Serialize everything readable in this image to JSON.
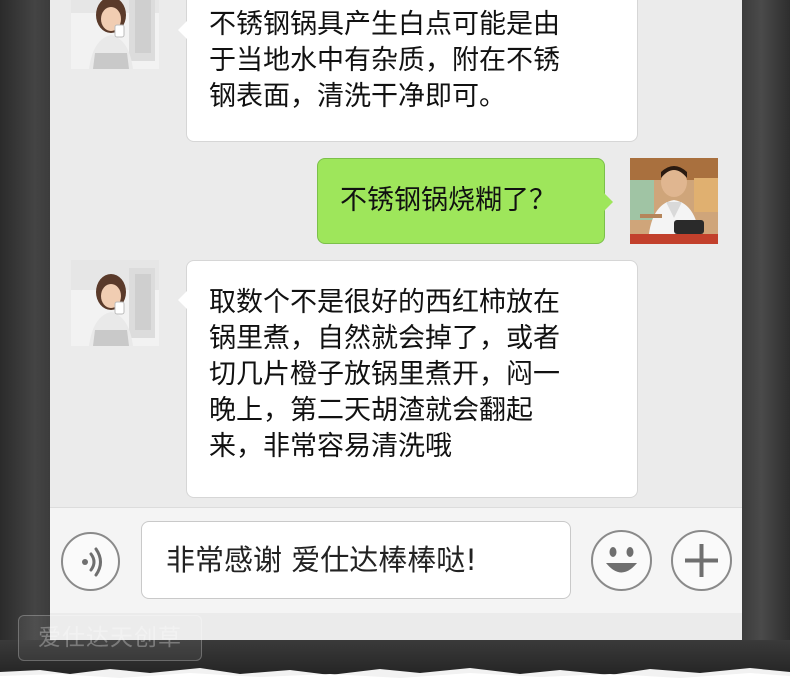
{
  "messages": [
    {
      "sender": "other",
      "lines": [
        "不锈钢锅具产生白点可能是由",
        "于当地水中有杂质，附在不锈",
        "钢表面，清洗干净即可。"
      ]
    },
    {
      "sender": "self",
      "lines": [
        "不锈钢锅烧糊了？"
      ]
    },
    {
      "sender": "other",
      "lines": [
        "取数个不是很好的西红柿放在",
        "锅里煮，自然就会掉了，或者",
        "切几片橙子放锅里煮开，闷一",
        "晚上，第二天胡渣就会翻起",
        "来，非常容易清洗哦"
      ]
    }
  ],
  "input": {
    "value": "非常感谢 爱仕达棒棒哒!",
    "voice_icon": "voice-icon",
    "emoji_icon": "emoji-icon",
    "plus_icon": "plus-icon"
  },
  "watermark": "爱仕达天创草",
  "colors": {
    "chat_background": "#ebebeb",
    "self_bubble": "#9ee65b",
    "other_bubble": "#ffffff"
  }
}
